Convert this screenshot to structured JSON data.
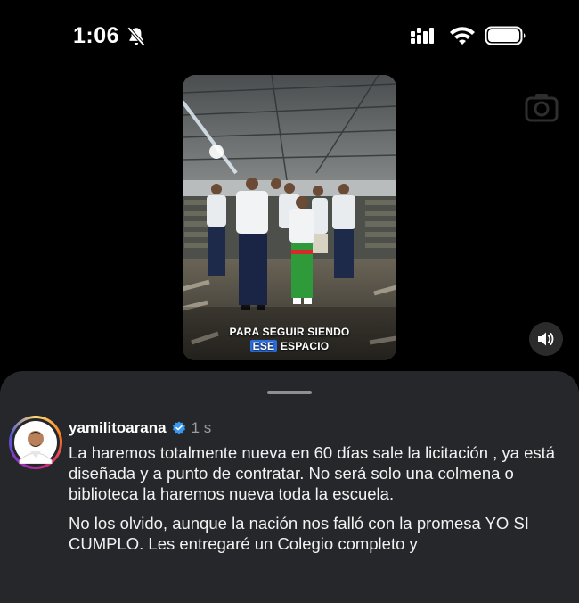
{
  "status_bar": {
    "time": "1:06",
    "icons": [
      "bell-slash-icon",
      "cellular-signal-icon",
      "wifi-icon",
      "battery-icon"
    ]
  },
  "video": {
    "caption_line1": "PARA SEGUIR SIENDO",
    "caption_highlight": "ESE",
    "caption_rest": "ESPACIO",
    "highlight_color": "#2a6de0"
  },
  "controls": {
    "volume_icon": "speaker-icon",
    "camera_icon": "camera-icon"
  },
  "comment": {
    "username": "yamilitoarana",
    "verified_icon": "verified-badge-icon",
    "time_ago": "1 s",
    "paragraph1": "La haremos totalmente nueva en 60 días sale la licitación , ya está diseñada y a punto de contratar. No será solo una colmena o biblioteca la haremos nueva toda la escuela.",
    "paragraph2": "No los olvido, aunque la nación nos falló con la promesa YO SI CUMPLO. Les entregaré un Colegio completo y"
  },
  "colors": {
    "background": "#000000",
    "sheet": "#25272a",
    "verified": "#3897f0",
    "muted_text": "#9a9ca0"
  }
}
